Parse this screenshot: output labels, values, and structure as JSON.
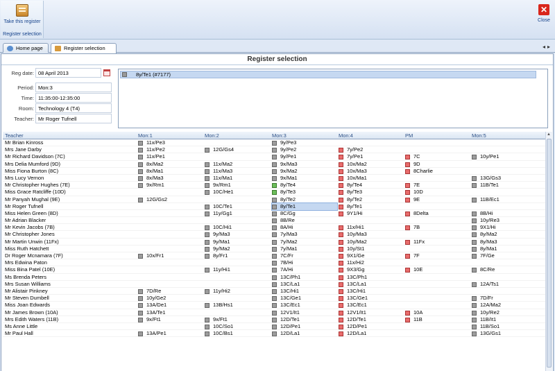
{
  "ribbon": {
    "take_register_label": "Take this register",
    "group_label": "Register selection",
    "close_label": "Close"
  },
  "tabs": [
    {
      "label": "Home page"
    },
    {
      "label": "Register selection"
    }
  ],
  "title": "Register selection",
  "form": {
    "reg_date_label": "Reg date:",
    "reg_date": "08 April 2013",
    "period_label": "Period:",
    "period": "Mon:3",
    "time_label": "Time:",
    "time": "11:35:00-12:35:00",
    "room_label": "Room:",
    "room": "Technology 4 (T4)",
    "teacher_label": "Teacher:",
    "teacher": "Mr Roger Tufnell"
  },
  "selected_register": "8y/Te1 (#7177)",
  "table": {
    "columns": [
      "Teacher",
      "Mon:1",
      "Mon:2",
      "Mon:3",
      "Mon:4",
      "PM",
      "Mon:5"
    ],
    "rows": [
      {
        "teacher": "Mr Brian Kinross",
        "c": [
          [
            "g",
            "11x/Pe3"
          ],
          null,
          [
            "g",
            "9y/Pe3"
          ],
          null,
          null,
          null
        ]
      },
      {
        "teacher": "Mrs Jane Darby",
        "c": [
          [
            "g",
            "11x/Pe2"
          ],
          [
            "g",
            "12G/Gs4"
          ],
          [
            "g",
            "9y/Pe2"
          ],
          [
            "r",
            "7y/Pe2"
          ],
          null,
          null
        ]
      },
      {
        "teacher": "Mr Richard Davidson (7C)",
        "c": [
          [
            "g",
            "11x/Pe1"
          ],
          null,
          [
            "g",
            "9y/Pe1"
          ],
          [
            "r",
            "7y/Pe1"
          ],
          [
            "r",
            "7C"
          ],
          [
            "g",
            "10y/Pe1"
          ]
        ]
      },
      {
        "teacher": "Mrs Delia Mumford (9D)",
        "c": [
          [
            "g",
            "8x/Ma2"
          ],
          [
            "g",
            "11x/Ma2"
          ],
          [
            "g",
            "9x/Ma3"
          ],
          [
            "r",
            "10x/Ma2"
          ],
          [
            "r",
            "9D"
          ],
          null
        ]
      },
      {
        "teacher": "Miss Fiona Burton (8C)",
        "c": [
          [
            "g",
            "8x/Ma1"
          ],
          [
            "g",
            "11x/Ma3"
          ],
          [
            "g",
            "9x/Ma2"
          ],
          [
            "r",
            "10x/Ma3"
          ],
          [
            "r",
            "8Charlie"
          ],
          null
        ]
      },
      {
        "teacher": "Mrs Lucy Vernon",
        "c": [
          [
            "g",
            "8x/Ma3"
          ],
          [
            "g",
            "11x/Ma1"
          ],
          [
            "g",
            "9x/Ma1"
          ],
          [
            "r",
            "10x/Ma1"
          ],
          null,
          [
            "g",
            "13G/Gs3"
          ]
        ]
      },
      {
        "teacher": "Mr Christopher Hughes (7E)",
        "c": [
          [
            "g",
            "9x/Rm1"
          ],
          [
            "g",
            "9x/Rm1"
          ],
          [
            "gr",
            "8y/Te4"
          ],
          [
            "r",
            "8y/Te4"
          ],
          [
            "r",
            "7E"
          ],
          [
            "g",
            "11B/Te1"
          ]
        ]
      },
      {
        "teacher": "Miss Grace Ratcliffe (10D)",
        "c": [
          null,
          [
            "g",
            "10C/He1"
          ],
          [
            "gr",
            "8y/Te3"
          ],
          [
            "r",
            "8y/Te3"
          ],
          [
            "r",
            "10D"
          ],
          null
        ]
      },
      {
        "teacher": "Mr Panyah Mughal (9E)",
        "c": [
          [
            "g",
            "12G/Gs2"
          ],
          null,
          [
            "g",
            "8y/Te2"
          ],
          [
            "r",
            "8y/Te2"
          ],
          [
            "r",
            "9E"
          ],
          [
            "g",
            "11B/Ec1"
          ]
        ]
      },
      {
        "teacher": "Mr Roger Tufnell",
        "c": [
          null,
          [
            "g",
            "10C/Te1"
          ],
          [
            "g",
            "8y/Te1"
          ],
          [
            "r",
            "8y/Te1"
          ],
          null,
          null
        ],
        "hl": 2
      },
      {
        "teacher": "Miss Helen Green (8D)",
        "c": [
          null,
          [
            "g",
            "11y/Gg1"
          ],
          [
            "g",
            "8C/Gg"
          ],
          [
            "r",
            "9Y1/Hi"
          ],
          [
            "r",
            "8Delta"
          ],
          [
            "g",
            "8B/Hi"
          ]
        ]
      },
      {
        "teacher": "Mr Adrian Blacker",
        "c": [
          null,
          null,
          [
            "g",
            "8B/Re"
          ],
          null,
          null,
          [
            "g",
            "10y/Re3"
          ]
        ]
      },
      {
        "teacher": "Mr Kevin Jacobs (7B)",
        "c": [
          null,
          [
            "g",
            "10C/Hi1"
          ],
          [
            "g",
            "8A/Hi"
          ],
          [
            "r",
            "11x/Hi1"
          ],
          [
            "r",
            "7B"
          ],
          [
            "g",
            "9X1/Hi"
          ]
        ]
      },
      {
        "teacher": "Mr Christopher Jones",
        "c": [
          null,
          [
            "g",
            "9y/Ma3"
          ],
          [
            "g",
            "7y/Ma3"
          ],
          [
            "r",
            "10y/Ma3"
          ],
          null,
          [
            "g",
            "8y/Ma2"
          ]
        ]
      },
      {
        "teacher": "Mr Martin Unwin (11Fx)",
        "c": [
          null,
          [
            "g",
            "9y/Ma1"
          ],
          [
            "g",
            "7y/Ma2"
          ],
          [
            "r",
            "10y/Ma2"
          ],
          [
            "r",
            "11Fx"
          ],
          [
            "g",
            "8y/Ma3"
          ]
        ]
      },
      {
        "teacher": "Miss Ruth Hatchett",
        "c": [
          null,
          [
            "g",
            "9y/Ma2"
          ],
          [
            "g",
            "7y/Ma1"
          ],
          [
            "r",
            "10y/St1"
          ],
          null,
          [
            "g",
            "8y/Ma1"
          ]
        ]
      },
      {
        "teacher": "Dr Roger Mcnamara (7F)",
        "c": [
          [
            "g",
            "10x/Fr1"
          ],
          [
            "g",
            "8y/Fr1"
          ],
          [
            "g",
            "7C/Fr"
          ],
          [
            "r",
            "9X1/Ge"
          ],
          [
            "r",
            "7F"
          ],
          [
            "g",
            "7F/Ge"
          ]
        ]
      },
      {
        "teacher": "Mrs Edwina Paton",
        "c": [
          null,
          null,
          [
            "g",
            "7B/Hi"
          ],
          [
            "r",
            "11x/Hi2"
          ],
          null,
          null
        ]
      },
      {
        "teacher": "Miss Bina Patel (10E)",
        "c": [
          null,
          [
            "g",
            "11y/Hi1"
          ],
          [
            "g",
            "7A/Hi"
          ],
          [
            "r",
            "9X3/Gg"
          ],
          [
            "r",
            "10E"
          ],
          [
            "g",
            "8C/Re"
          ]
        ]
      },
      {
        "teacher": "Ms Brenda Peters",
        "c": [
          null,
          null,
          [
            "g",
            "13C/Ph1"
          ],
          [
            "r",
            "13C/Ph1"
          ],
          null,
          null
        ]
      },
      {
        "teacher": "Mrs Susan Williams",
        "c": [
          null,
          null,
          [
            "g",
            "13C/La1"
          ],
          [
            "r",
            "13C/La1"
          ],
          null,
          [
            "g",
            "12A/Ts1"
          ]
        ]
      },
      {
        "teacher": "Mr Alistair Pinkney",
        "c": [
          [
            "g",
            "7D/Re"
          ],
          [
            "g",
            "11y/Hi2"
          ],
          [
            "g",
            "13C/Hi1"
          ],
          [
            "r",
            "13C/Hi1"
          ],
          null,
          null
        ]
      },
      {
        "teacher": "Mr Steven Dumbell",
        "c": [
          [
            "g",
            "10y/Ge2"
          ],
          null,
          [
            "g",
            "13C/Ge1"
          ],
          [
            "r",
            "13C/Ge1"
          ],
          null,
          [
            "g",
            "7D/Fr"
          ]
        ]
      },
      {
        "teacher": "Miss Joan Edwards",
        "c": [
          [
            "g",
            "13A/De1"
          ],
          [
            "g",
            "13B/Hs1"
          ],
          [
            "g",
            "13C/Ec1"
          ],
          [
            "r",
            "13C/Ec1"
          ],
          null,
          [
            "g",
            "12A/Ma2"
          ]
        ]
      },
      {
        "teacher": "Mr James Brown (10A)",
        "c": [
          [
            "g",
            "13A/Te1"
          ],
          null,
          [
            "g",
            "12V1/It1"
          ],
          [
            "r",
            "12V1/It1"
          ],
          [
            "r",
            "10A"
          ],
          [
            "g",
            "10y/Re2"
          ]
        ]
      },
      {
        "teacher": "Mrs Edith Waters (11B)",
        "c": [
          [
            "g",
            "9x/Ft1"
          ],
          [
            "g",
            "9x/Ft1"
          ],
          [
            "g",
            "12D/Te1"
          ],
          [
            "r",
            "12D/Te1"
          ],
          [
            "r",
            "11B"
          ],
          [
            "g",
            "11B/It1"
          ]
        ]
      },
      {
        "teacher": "Ms Anne Little",
        "c": [
          null,
          [
            "g",
            "10C/So1"
          ],
          [
            "g",
            "12D/Pe1"
          ],
          [
            "r",
            "12D/Pe1"
          ],
          null,
          [
            "g",
            "11B/So1"
          ]
        ]
      },
      {
        "teacher": "Mr Paul Hall",
        "c": [
          [
            "g",
            "13A/Pe1"
          ],
          [
            "g",
            "10C/Bs1"
          ],
          [
            "g",
            "12D/La1"
          ],
          [
            "r",
            "12D/La1"
          ],
          null,
          [
            "g",
            "13G/Gs1"
          ]
        ]
      }
    ]
  }
}
